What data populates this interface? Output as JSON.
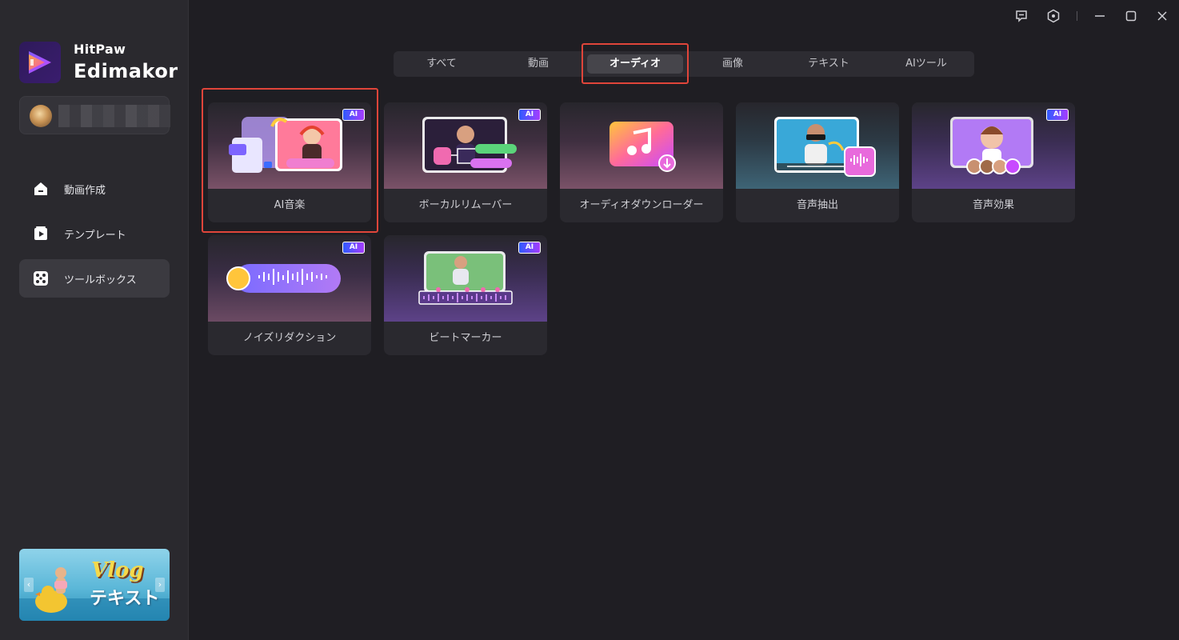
{
  "app": {
    "brand_top": "HitPaw",
    "brand_bottom": "Edimakor"
  },
  "sidebar": {
    "items": [
      {
        "label": "動画作成",
        "icon": "home-icon"
      },
      {
        "label": "テンプレート",
        "icon": "template-icon"
      },
      {
        "label": "ツールボックス",
        "icon": "toolbox-icon",
        "active": true
      }
    ],
    "banner": {
      "title": "Vlog",
      "subtitle": "テキスト"
    }
  },
  "titlebar": {
    "icons": [
      "feedback-icon",
      "settings-icon",
      "minimize-icon",
      "maximize-icon",
      "close-icon"
    ]
  },
  "tabs": [
    {
      "label": "すべて"
    },
    {
      "label": "動画"
    },
    {
      "label": "オーディオ",
      "active": true
    },
    {
      "label": "画像"
    },
    {
      "label": "テキスト"
    },
    {
      "label": "AIツール"
    }
  ],
  "tools": [
    {
      "label": "AI音楽",
      "ai": "AI"
    },
    {
      "label": "ボーカルリムーバー",
      "ai": "AI"
    },
    {
      "label": "オーディオダウンローダー"
    },
    {
      "label": "音声抽出"
    },
    {
      "label": "音声効果",
      "ai": "AI"
    },
    {
      "label": "ノイズリダクション",
      "ai": "AI"
    },
    {
      "label": "ビートマーカー",
      "ai": "AI"
    }
  ],
  "colors": {
    "accent_highlight": "#e0453a",
    "ai_badge_start": "#2f5bff",
    "ai_badge_end": "#a63dff"
  }
}
